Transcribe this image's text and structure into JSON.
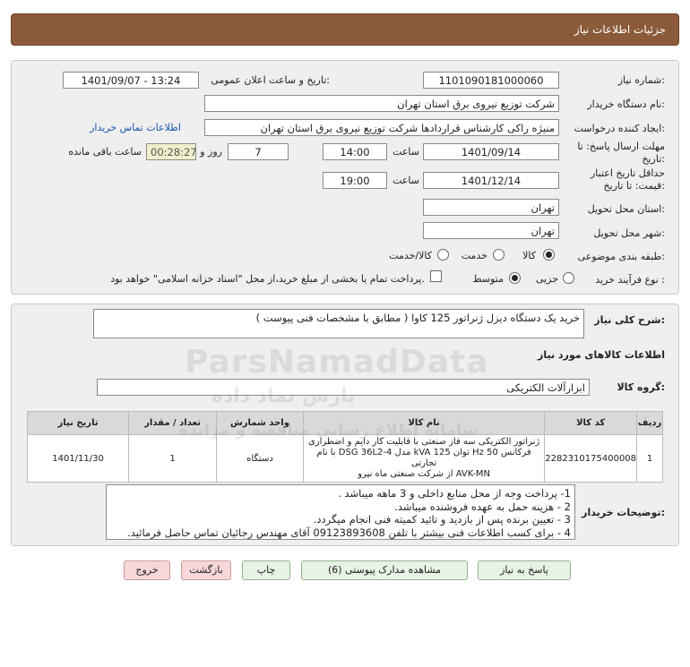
{
  "header": {
    "title": "جزئیات اطلاعات نیاز"
  },
  "fields": {
    "need_number_label": "شماره نیاز:",
    "need_number": "1101090181000060",
    "announce_label": "تاریخ و ساعت اعلان عمومی:",
    "announce_value": "1401/09/07 - 13:24",
    "buyer_label": "نام دستگاه خریدار:",
    "buyer_value": "شرکت توزیع نیروی برق استان تهران",
    "creator_label": "ایجاد کننده درخواست:",
    "creator_value": "منیژه راکی کارشناس قراردادها شرکت توزیع نیروی برق استان تهران",
    "contact_link": "اطلاعات تماس خریدار",
    "deadline_label": "مهلت ارسال پاسخ: تا تاریخ:",
    "deadline_date": "1401/09/14",
    "time_label": "ساعت",
    "deadline_time": "14:00",
    "days_value": "7",
    "days_label": "روز و",
    "remaining_value": "00:28:27",
    "remaining_label": "ساعت باقی مانده",
    "validity_label": "حداقل تاریخ اعتبار قیمت: تا تاریخ:",
    "validity_date": "1401/12/14",
    "validity_time": "19:00",
    "province_label": "استان محل تحویل:",
    "province_value": "تهران",
    "city_label": "شهر محل تحویل:",
    "city_value": "تهران",
    "category_label": "طبقه بندی موضوعی:",
    "category_options": [
      "کالا",
      "خدمت",
      "کالا/خدمت"
    ],
    "process_label": "نوع فرآیند خرید :",
    "process_options": [
      "جزیی",
      "متوسط"
    ],
    "payment_note": "پرداخت تمام یا بخشی از مبلغ خرید،از محل \"اسناد خزانه اسلامی\" خواهد بود."
  },
  "summary": {
    "label": "شرح کلی نیاز:",
    "value": "خرید یک دستگاه دیزل ژنراتور 125 کاوا ( مطابق با مشخصات فنی پیوست )"
  },
  "goods": {
    "section_title": "اطلاعات کالاهای مورد نیاز",
    "group_label": "گروه کالا:",
    "group_value": "ابزارآلات الکتریکی",
    "columns": [
      "ردیف",
      "کد کالا",
      "نام کالا",
      "واحد شمارش",
      "تعداد / مقدار",
      "تاریخ نیاز"
    ],
    "rows": [
      {
        "row": "1",
        "code": "2282310175400008",
        "name_line1": "ژنراتور الکتریکی سه فاز صنعتی با قابلیت کار دایم و اضطراری",
        "name_line2": "فرکانس Hz 50 توان kVA 125 مدل DSG 36L2-4 با نام تجارتی",
        "name_line3": "AVK-MN از شرکت صنعتی ماه نیرو",
        "unit": "دستگاه",
        "qty": "1",
        "date": "1401/11/30"
      }
    ]
  },
  "buyer_notes": {
    "label": "توضیحات خریدار:",
    "lines": [
      "1- پرداخت وجه از محل منابع داخلی و 3 ماهه میباشد .",
      "2 - هزینه حمل به عهده فروشنده میباشد.",
      "3 - تعیین برنده پس از بازدید و تائید کمیته فنی انجام میگردد.",
      "4 - برای کسب اطلاعات فنی بیشتر با تلفن 09123893608 آقای مهندس رجائیان تماس حاصل فرمائید."
    ]
  },
  "buttons": {
    "reply": "پاسخ به نیاز",
    "attachments": "مشاهده مدارک پیوستی (6)",
    "print": "چاپ",
    "back": "بازگشت",
    "exit": "خروج"
  },
  "watermark": {
    "brand": "ParsNamadData",
    "line1": "پارس نماد داده",
    "line2": "سامانه اطلاع رسانی مناقصه و مزایده"
  }
}
